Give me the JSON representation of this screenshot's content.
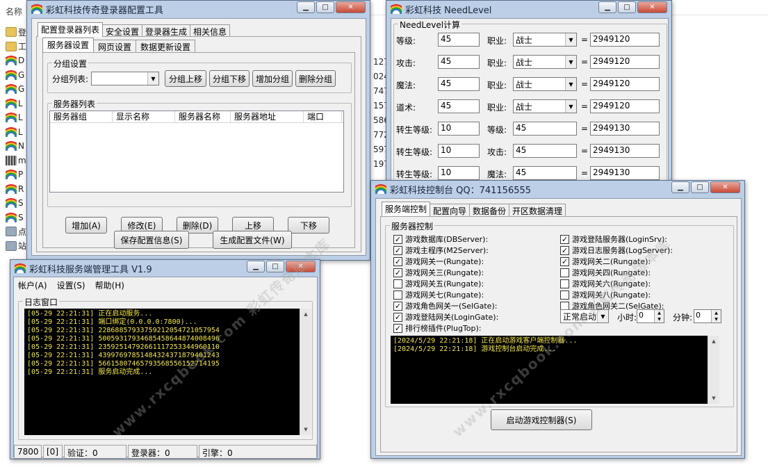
{
  "background": {
    "name_header": "名称",
    "rows": [
      "登",
      "工",
      "D",
      "G",
      "G",
      "L",
      "L",
      "L",
      "N",
      "m",
      "P",
      "R",
      "S",
      "S",
      "点",
      "站"
    ],
    "row_icons": [
      "folder",
      "folder",
      "rainbow",
      "rainbow",
      "rainbow",
      "rainbow",
      "rainbow",
      "rainbow",
      "rainbow",
      "grid",
      "rainbow",
      "rainbow",
      "rainbow",
      "rainbow",
      "exe",
      "exe"
    ],
    "numbers": [
      "127",
      "024",
      "747",
      "157",
      "586",
      "772",
      "597",
      "197"
    ]
  },
  "login_tool": {
    "title": "彩虹科技传奇登录器配置工具",
    "main_tabs": [
      "配置登录器列表",
      "安全设置",
      "登录器生成",
      "相关信息"
    ],
    "sub_tabs": [
      "服务器设置",
      "网页设置",
      "数据更新设置"
    ],
    "group_settings_label": "分组设置",
    "group_list_label": "分组列表:",
    "group_buttons": [
      "分组上移",
      "分组下移",
      "增加分组",
      "删除分组"
    ],
    "server_list_label": "服务器列表",
    "columns": [
      "服务器组",
      "显示名称",
      "服务器名称",
      "服务器地址",
      "端口"
    ],
    "action_buttons": [
      "增加(A)",
      "修改(E)",
      "删除(D)",
      "上移",
      "下移"
    ],
    "save_button": "保存配置信息(S)",
    "generate_button": "生成配置文件(W)"
  },
  "needlevel": {
    "title": "彩虹科技 NeedLevel",
    "group_label": "NeedLevel计算",
    "rows": [
      {
        "label": "等级:",
        "value": "45",
        "label2": "职业:",
        "value2": "战士",
        "type2": "combo",
        "result": "2949120"
      },
      {
        "label": "攻击:",
        "value": "45",
        "label2": "职业:",
        "value2": "战士",
        "type2": "combo",
        "result": "2949120"
      },
      {
        "label": "魔法:",
        "value": "45",
        "label2": "职业:",
        "value2": "战士",
        "type2": "combo",
        "result": "2949120"
      },
      {
        "label": "道术:",
        "value": "45",
        "label2": "职业:",
        "value2": "战士",
        "type2": "combo",
        "result": "2949120"
      },
      {
        "label": "转生等级:",
        "value": "10",
        "label2": "等级:",
        "value2": "45",
        "type2": "input",
        "result": "2949130"
      },
      {
        "label": "转生等级:",
        "value": "10",
        "label2": "攻击:",
        "value2": "45",
        "type2": "input",
        "result": "2949130"
      },
      {
        "label": "转生等级:",
        "value": "10",
        "label2": "魔法:",
        "value2": "45",
        "type2": "input",
        "result": "2949130"
      }
    ],
    "equals": "="
  },
  "control": {
    "title": "彩虹科技控制台 QQ：741156555",
    "tabs": [
      "服务端控制",
      "配置向导",
      "数据备份",
      "开区数据清理"
    ],
    "group_label": "服务器控制",
    "left_checks": [
      {
        "label": "游戏数据库(DBServer):",
        "checked": true
      },
      {
        "label": "游戏主程序(M2Server):",
        "checked": true
      },
      {
        "label": "游戏网关一(Rungate):",
        "checked": true
      },
      {
        "label": "游戏网关三(Rungate):",
        "checked": true
      },
      {
        "label": "游戏网关五(Rungate):",
        "checked": false
      },
      {
        "label": "游戏网关七(Rungate):",
        "checked": false
      },
      {
        "label": "游戏角色网关一(SelGate):",
        "checked": true
      },
      {
        "label": "游戏登陆网关(LoginGate):",
        "checked": true
      },
      {
        "label": "排行榜插件(PlugTop):",
        "checked": true
      }
    ],
    "right_checks": [
      {
        "label": "游戏登陆服务器(LoginSrv):",
        "checked": true
      },
      {
        "label": "游戏日志服务器(LogServer):",
        "checked": true
      },
      {
        "label": "游戏网关二(Rungate):",
        "checked": true
      },
      {
        "label": "游戏网关四(Rungate):",
        "checked": false
      },
      {
        "label": "游戏网关六(Rungate):",
        "checked": false
      },
      {
        "label": "游戏网关八(Rungate):",
        "checked": false
      },
      {
        "label": "游戏角色网关二(SelGate):",
        "checked": false
      }
    ],
    "start_mode": "正常启动",
    "hour_label": "小时:",
    "hour_value": "0",
    "minute_label": "分钟:",
    "minute_value": "0",
    "log": "[2024/5/29 22:21:18] 正在启动游戏客户端控制器...\n[2024/5/29 22:21:18] 游戏控制台启动完成...",
    "start_button": "启动游戏控制器(S)"
  },
  "server_mgr": {
    "title": "彩虹科技服务端管理工具 V1.9",
    "menu": [
      "帐户(A)",
      "设置(S)",
      "帮助(H)"
    ],
    "log_label": "日志窗口",
    "log": "[05-29 22:21:31] 正在启动服务...\n[05-29 22:21:31] 端口绑定(0.0.0.0:7800)...\n[05-29 22:21:31] 22868857933759212054721057954\n[05-29 22:21:31] 50059317934685458644874008496\n[05-29 22:21:31] 23592514792661117253344960110\n[05-29 22:21:31] 43997697851484324371879401243\n[05-29 22:21:31] 56615807465793568556152714195\n[05-29 22:21:31] 服务启动完成...",
    "status": [
      "7800",
      "[0]",
      "验证：0",
      "登录器：0",
      "引擎：0"
    ]
  },
  "watermark": "www.rxcqbook.com  彩虹传奇版本库"
}
